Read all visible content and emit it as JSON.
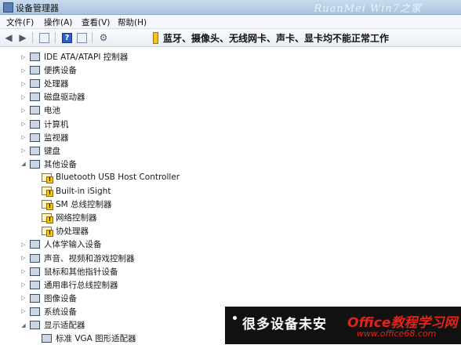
{
  "window": {
    "title": "设备管理器",
    "watermark": "RuanMei  Win7之家"
  },
  "menu": [
    "文件(F)",
    "操作(A)",
    "查看(V)",
    "帮助(H)"
  ],
  "toolbar": {
    "buttons": [
      "back-icon",
      "forward-icon",
      "properties-icon",
      "help-icon",
      "properties-icon",
      "scan-icon"
    ],
    "help_glyph": "?",
    "notice": "蓝牙、摄像头、无线网卡、声卡、显卡均不能正常工作"
  },
  "tree": [
    {
      "label": "IDE ATA/ATAPI 控制器",
      "expander": "▷",
      "level": 0,
      "icon": "ide-controller-icon",
      "warn": false
    },
    {
      "label": "便携设备",
      "expander": "▷",
      "level": 0,
      "icon": "portable-device-icon",
      "warn": false
    },
    {
      "label": "处理器",
      "expander": "▷",
      "level": 0,
      "icon": "processor-icon",
      "warn": false
    },
    {
      "label": "磁盘驱动器",
      "expander": "▷",
      "level": 0,
      "icon": "disk-drive-icon",
      "warn": false
    },
    {
      "label": "电池",
      "expander": "▷",
      "level": 0,
      "icon": "battery-icon",
      "warn": false
    },
    {
      "label": "计算机",
      "expander": "▷",
      "level": 0,
      "icon": "computer-icon",
      "warn": false
    },
    {
      "label": "监视器",
      "expander": "▷",
      "level": 0,
      "icon": "monitor-icon",
      "warn": false
    },
    {
      "label": "键盘",
      "expander": "▷",
      "level": 0,
      "icon": "keyboard-icon",
      "warn": false
    },
    {
      "label": "其他设备",
      "expander": "◢",
      "level": 0,
      "icon": "unknown-device-icon",
      "warn": false
    },
    {
      "label": "Bluetooth USB Host Controller",
      "expander": "",
      "level": 1,
      "icon": "warning-device-icon",
      "warn": true
    },
    {
      "label": "Built-in iSight",
      "expander": "",
      "level": 1,
      "icon": "warning-device-icon",
      "warn": true
    },
    {
      "label": "SM 总线控制器",
      "expander": "",
      "level": 1,
      "icon": "warning-device-icon",
      "warn": true
    },
    {
      "label": "网络控制器",
      "expander": "",
      "level": 1,
      "icon": "warning-device-icon",
      "warn": true
    },
    {
      "label": "协处理器",
      "expander": "",
      "level": 1,
      "icon": "warning-device-icon",
      "warn": true
    },
    {
      "label": "人体学输入设备",
      "expander": "▷",
      "level": 0,
      "icon": "hid-icon",
      "warn": false
    },
    {
      "label": "声音、视频和游戏控制器",
      "expander": "▷",
      "level": 0,
      "icon": "sound-icon",
      "warn": false
    },
    {
      "label": "鼠标和其他指针设备",
      "expander": "▷",
      "level": 0,
      "icon": "mouse-icon",
      "warn": false
    },
    {
      "label": "通用串行总线控制器",
      "expander": "▷",
      "level": 0,
      "icon": "usb-icon",
      "warn": false
    },
    {
      "label": "图像设备",
      "expander": "▷",
      "level": 0,
      "icon": "imaging-icon",
      "warn": false
    },
    {
      "label": "系统设备",
      "expander": "▷",
      "level": 0,
      "icon": "system-device-icon",
      "warn": false
    },
    {
      "label": "显示适配器",
      "expander": "◢",
      "level": 0,
      "icon": "display-adapter-icon",
      "warn": false
    },
    {
      "label": "标准 VGA 图形适配器",
      "expander": "",
      "level": 1,
      "icon": "display-adapter-icon",
      "warn": false
    }
  ],
  "caption": {
    "text": "很多设备未安",
    "logo": "Office教程学习网",
    "logo_url": "www.office68.com"
  }
}
